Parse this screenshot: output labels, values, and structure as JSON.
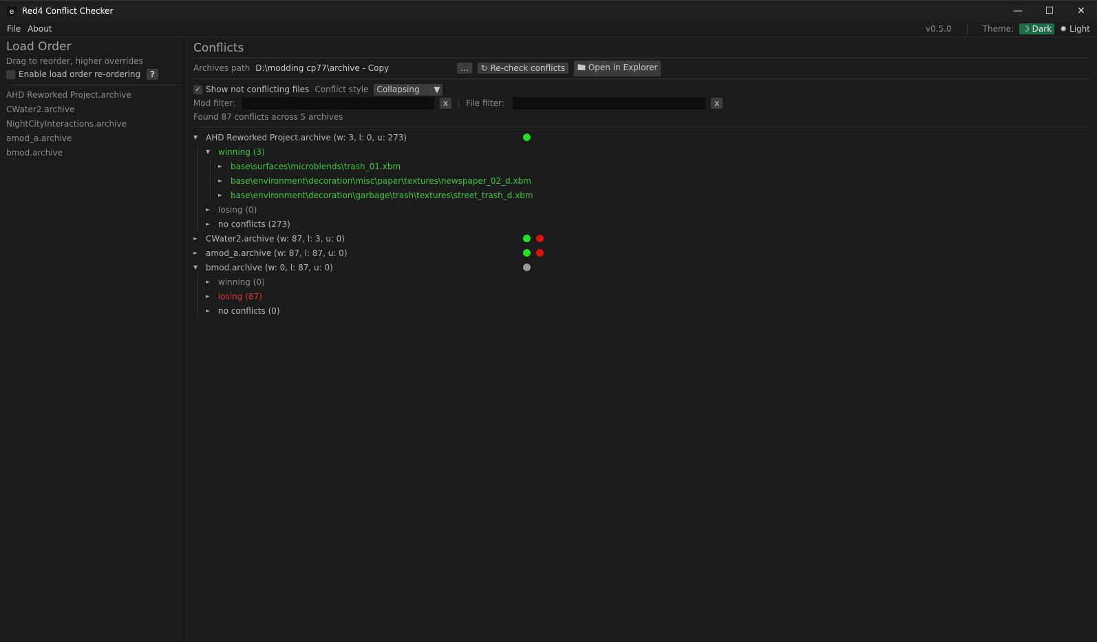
{
  "window": {
    "title": "Red4 Conflict Checker",
    "minimize": "—",
    "maximize": "☐",
    "close": "✕"
  },
  "menu": [
    "File",
    "About"
  ],
  "version": "v0.5.0",
  "theme": {
    "label": "Theme:",
    "dark": "☽ Dark",
    "light": "✹ Light",
    "selected": "Dark"
  },
  "sidebar": {
    "title": "Load Order",
    "hint": "Drag to reorder, higher overrides",
    "reorder_label": "Enable load order re-ordering",
    "reorder_checked": false,
    "help": "?",
    "items": [
      "AHD Reworked Project.archive",
      "CWater2.archive",
      "NightCityInteractions.archive",
      "amod_a.archive",
      "bmod.archive"
    ]
  },
  "main": {
    "title": "Conflicts",
    "path_label": "Archives path",
    "path_value": "D:\\modding cp77\\archive - Copy",
    "browse": "...",
    "recheck": "↻ Re-check conflicts",
    "open": "🖿 Open in Explorer",
    "show_label": "Show not conflicting files",
    "show_checked": "✓",
    "style_label": "Conflict style",
    "style_value": "Collapsing",
    "mod_filter_label": "Mod filter:",
    "file_filter_label": "File filter:",
    "clear": "x",
    "summary": "Found 87 conflicts across 5 archives"
  },
  "tree": {
    "a1": "AHD Reworked Project.archive (w: 3, l: 0, u: 273)",
    "a1_win": "winning (3)",
    "f1": "base\\surfaces\\microblends\\trash_01.xbm",
    "f2": "base\\environment\\decoration\\misc\\paper\\textures\\newspaper_02_d.xbm",
    "f3": "base\\environment\\decoration\\garbage\\trash\\textures\\street_trash_d.xbm",
    "a1_lose": "losing (0)",
    "a1_none": "no conflicts (273)",
    "a2": "CWater2.archive (w: 87, l: 3, u: 0)",
    "a3": "amod_a.archive (w: 87, l: 87, u: 0)",
    "a4": "bmod.archive (w: 0, l: 87, u: 0)",
    "a4_win": "winning (0)",
    "a4_lose": "losing (87)",
    "a4_none": "no conflicts (0)"
  },
  "colors": {
    "green": "#22e022",
    "red": "#e01010",
    "gray": "#9a9a9a"
  }
}
